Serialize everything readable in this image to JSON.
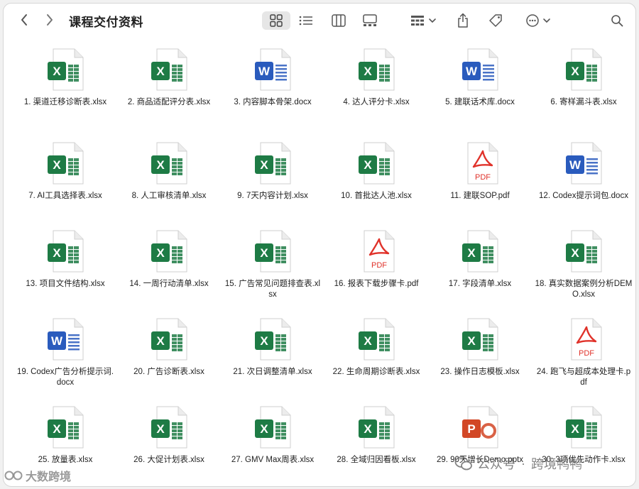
{
  "window": {
    "title": "课程交付资料"
  },
  "toolbar": {
    "icons": [
      "back-chevron-icon",
      "forward-chevron-icon",
      "grid-view-icon",
      "list-view-icon",
      "column-view-icon",
      "gallery-view-icon",
      "group-by-icon",
      "share-icon",
      "tag-icon",
      "more-actions-icon",
      "search-icon"
    ]
  },
  "files": [
    {
      "name": "1. 渠道迁移诊断表.xlsx",
      "type": "xlsx"
    },
    {
      "name": "2. 商品适配评分表.xlsx",
      "type": "xlsx"
    },
    {
      "name": "3. 内容脚本骨架.docx",
      "type": "docx"
    },
    {
      "name": "4. 达人评分卡.xlsx",
      "type": "xlsx"
    },
    {
      "name": "5. 建联话术库.docx",
      "type": "docx"
    },
    {
      "name": "6. 寄样漏斗表.xlsx",
      "type": "xlsx"
    },
    {
      "name": "7. AI工具选择表.xlsx",
      "type": "xlsx"
    },
    {
      "name": "8. 人工审核清单.xlsx",
      "type": "xlsx"
    },
    {
      "name": "9. 7天内容计划.xlsx",
      "type": "xlsx"
    },
    {
      "name": "10. 首批达人池.xlsx",
      "type": "xlsx"
    },
    {
      "name": "11. 建联SOP.pdf",
      "type": "pdf"
    },
    {
      "name": "12. Codex提示词包.docx",
      "type": "docx"
    },
    {
      "name": "13. 项目文件结构.xlsx",
      "type": "xlsx"
    },
    {
      "name": "14. 一周行动清单.xlsx",
      "type": "xlsx"
    },
    {
      "name": "15. 广告常见问题排查表.xlsx",
      "type": "xlsx"
    },
    {
      "name": "16. 报表下载步骤卡.pdf",
      "type": "pdf"
    },
    {
      "name": "17. 字段清单.xlsx",
      "type": "xlsx"
    },
    {
      "name": "18. 真实数据案例分析DEMO.xlsx",
      "type": "xlsx"
    },
    {
      "name": "19. Codex广告分析提示词.docx",
      "type": "docx"
    },
    {
      "name": "20. 广告诊断表.xlsx",
      "type": "xlsx"
    },
    {
      "name": "21. 次日调整清单.xlsx",
      "type": "xlsx"
    },
    {
      "name": "22. 生命周期诊断表.xlsx",
      "type": "xlsx"
    },
    {
      "name": "23. 操作日志模板.xlsx",
      "type": "xlsx"
    },
    {
      "name": "24. 跑飞与超成本处理卡.pdf",
      "type": "pdf"
    },
    {
      "name": "25. 放量表.xlsx",
      "type": "xlsx"
    },
    {
      "name": "26. 大促计划表.xlsx",
      "type": "xlsx"
    },
    {
      "name": "27. GMV Max周表.xlsx",
      "type": "xlsx"
    },
    {
      "name": "28. 全域归因看板.xlsx",
      "type": "xlsx"
    },
    {
      "name": "29. 90天增长Demo.pptx",
      "type": "pptx"
    },
    {
      "name": "30. 3项优先动作卡.xlsx",
      "type": "xlsx"
    }
  ],
  "watermark": {
    "left_text": "大数跨境",
    "right_prefix": "公众号",
    "right_dot": "·",
    "right_name": "跨境鸭鸭"
  },
  "colors": {
    "xlsx_green": "#1e7b45",
    "docx_blue": "#2a5bbd",
    "pdf_red": "#e0322a",
    "pptx_orange": "#d24726"
  }
}
